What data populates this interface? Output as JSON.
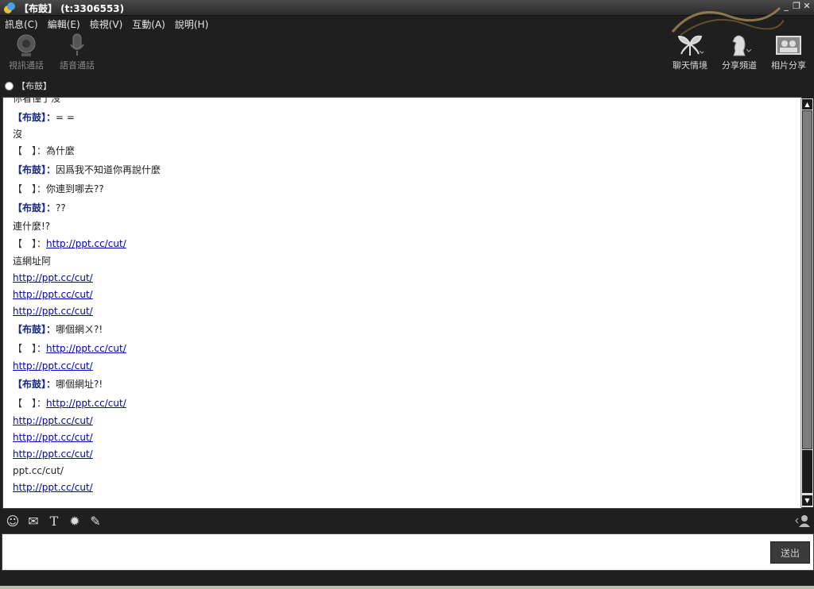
{
  "window": {
    "title": "【布鼓】 (t:3306553)",
    "controls": [
      "_",
      "❐",
      "✕"
    ]
  },
  "menu": [
    {
      "label": "訊息(C)"
    },
    {
      "label": "編輯(E)"
    },
    {
      "label": "檢視(V)"
    },
    {
      "label": "互動(A)"
    },
    {
      "label": "說明(H)"
    }
  ],
  "toolbar_left": [
    {
      "label": "視訊通話",
      "icon": "webcam-icon"
    },
    {
      "label": "語音通話",
      "icon": "microphone-icon"
    }
  ],
  "toolbar_right": [
    {
      "label": "聊天情境",
      "icon": "leaf-icon"
    },
    {
      "label": "分享頻道",
      "icon": "chess-knight-icon"
    },
    {
      "label": "相片分享",
      "icon": "photo-share-icon"
    }
  ],
  "contact": {
    "name": "【布鼓】",
    "status": "online"
  },
  "messages": [
    {
      "speaker": "",
      "sep": "",
      "text": "你看懂了沒",
      "link": false
    },
    {
      "speaker": "【布鼓】",
      "sep": "：",
      "text": "= =",
      "link": false
    },
    {
      "speaker": "",
      "sep": "",
      "text": "沒",
      "link": false
    },
    {
      "speaker": "【　】",
      "sep": "：",
      "text": "為什麼",
      "link": false
    },
    {
      "speaker": "【布鼓】",
      "sep": "：",
      "text": "因爲我不知道你再說什麼",
      "link": false
    },
    {
      "speaker": "【　】",
      "sep": "：",
      "text": "你連到哪去??",
      "link": false
    },
    {
      "speaker": "【布鼓】",
      "sep": "：",
      "text": "??",
      "link": false
    },
    {
      "speaker": "",
      "sep": "",
      "text": "連什麼!?",
      "link": false
    },
    {
      "speaker": "【　】",
      "sep": "：",
      "text": "http://ppt.cc/cut/",
      "link": true
    },
    {
      "speaker": "",
      "sep": "",
      "text": "這網址阿",
      "link": false
    },
    {
      "speaker": "",
      "sep": "",
      "text": "http://ppt.cc/cut/",
      "link": true
    },
    {
      "speaker": "",
      "sep": "",
      "text": "http://ppt.cc/cut/",
      "link": true
    },
    {
      "speaker": "",
      "sep": "",
      "text": "http://ppt.cc/cut/",
      "link": true
    },
    {
      "speaker": "【布鼓】",
      "sep": "：",
      "text": "哪個網ㄨ?!",
      "link": false
    },
    {
      "speaker": "【　】",
      "sep": "：",
      "text": "http://ppt.cc/cut/",
      "link": true
    },
    {
      "speaker": "",
      "sep": "",
      "text": "http://ppt.cc/cut/",
      "link": true
    },
    {
      "speaker": "【布鼓】",
      "sep": "：",
      "text": "哪個網址?!",
      "link": false
    },
    {
      "speaker": "【　】",
      "sep": "：",
      "text": "http://ppt.cc/cut/",
      "link": true
    },
    {
      "speaker": "",
      "sep": "",
      "text": "http://ppt.cc/cut/",
      "link": true
    },
    {
      "speaker": "",
      "sep": "",
      "text": "http://ppt.cc/cut/",
      "link": true
    },
    {
      "speaker": "",
      "sep": "",
      "text": "http://ppt.cc/cut/",
      "link": true
    },
    {
      "speaker": "",
      "sep": "",
      "text": "ppt.cc/cut/",
      "link": false
    },
    {
      "speaker": "",
      "sep": "",
      "text": "http://ppt.cc/cut/",
      "link": true
    }
  ],
  "chat_tools": [
    {
      "icon": "emoticon-icon",
      "glyph": "☺"
    },
    {
      "icon": "nudge-icon",
      "glyph": "✉"
    },
    {
      "icon": "font-icon",
      "glyph": "T"
    },
    {
      "icon": "wink-icon",
      "glyph": "✹"
    },
    {
      "icon": "attach-icon",
      "glyph": "✎"
    }
  ],
  "input": {
    "value": ""
  },
  "send_label": "送出",
  "colors": {
    "speaker": "#1a2b87",
    "link": "#0000c0",
    "chrome": "#1f1f1f"
  }
}
